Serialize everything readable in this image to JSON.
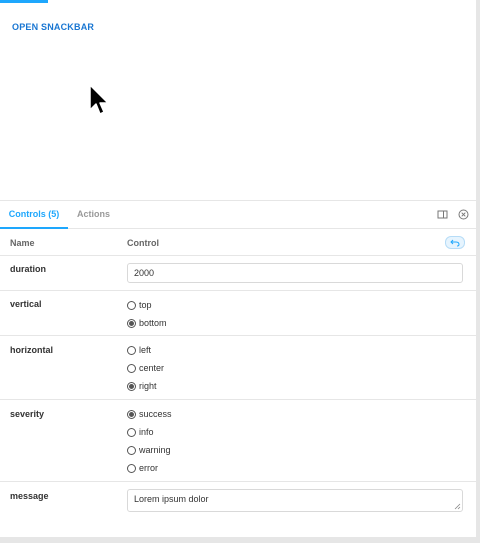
{
  "preview": {
    "button_label": "OPEN SNACKBAR"
  },
  "panel": {
    "tabs": [
      {
        "label": "Controls (5)"
      },
      {
        "label": "Actions"
      }
    ],
    "header": {
      "name": "Name",
      "control": "Control"
    },
    "accent_color": "#1ea7fd",
    "button_color": "#1976d2"
  },
  "controls": {
    "duration": {
      "name": "duration",
      "value": "2000"
    },
    "vertical": {
      "name": "vertical",
      "options": [
        "top",
        "bottom"
      ],
      "selected": "bottom"
    },
    "horizontal": {
      "name": "horizontal",
      "options": [
        "left",
        "center",
        "right"
      ],
      "selected": "right"
    },
    "severity": {
      "name": "severity",
      "options": [
        "success",
        "info",
        "warning",
        "error"
      ],
      "selected": "success"
    },
    "message": {
      "name": "message",
      "value": "Lorem ipsum dolor"
    }
  },
  "icons": {
    "cursor": "mouse-pointer-icon",
    "panel_toggle": "sidebar-toggle-icon",
    "close": "close-circle-icon",
    "reset": "undo-icon"
  }
}
